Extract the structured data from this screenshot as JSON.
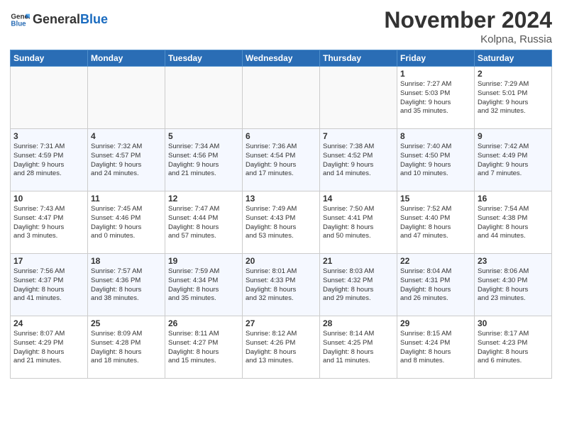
{
  "header": {
    "logo_text_general": "General",
    "logo_text_blue": "Blue",
    "month_title": "November 2024",
    "location": "Kolpna, Russia"
  },
  "weekdays": [
    "Sunday",
    "Monday",
    "Tuesday",
    "Wednesday",
    "Thursday",
    "Friday",
    "Saturday"
  ],
  "weeks": [
    [
      {
        "day": "",
        "info": ""
      },
      {
        "day": "",
        "info": ""
      },
      {
        "day": "",
        "info": ""
      },
      {
        "day": "",
        "info": ""
      },
      {
        "day": "",
        "info": ""
      },
      {
        "day": "1",
        "info": "Sunrise: 7:27 AM\nSunset: 5:03 PM\nDaylight: 9 hours\nand 35 minutes."
      },
      {
        "day": "2",
        "info": "Sunrise: 7:29 AM\nSunset: 5:01 PM\nDaylight: 9 hours\nand 32 minutes."
      }
    ],
    [
      {
        "day": "3",
        "info": "Sunrise: 7:31 AM\nSunset: 4:59 PM\nDaylight: 9 hours\nand 28 minutes."
      },
      {
        "day": "4",
        "info": "Sunrise: 7:32 AM\nSunset: 4:57 PM\nDaylight: 9 hours\nand 24 minutes."
      },
      {
        "day": "5",
        "info": "Sunrise: 7:34 AM\nSunset: 4:56 PM\nDaylight: 9 hours\nand 21 minutes."
      },
      {
        "day": "6",
        "info": "Sunrise: 7:36 AM\nSunset: 4:54 PM\nDaylight: 9 hours\nand 17 minutes."
      },
      {
        "day": "7",
        "info": "Sunrise: 7:38 AM\nSunset: 4:52 PM\nDaylight: 9 hours\nand 14 minutes."
      },
      {
        "day": "8",
        "info": "Sunrise: 7:40 AM\nSunset: 4:50 PM\nDaylight: 9 hours\nand 10 minutes."
      },
      {
        "day": "9",
        "info": "Sunrise: 7:42 AM\nSunset: 4:49 PM\nDaylight: 9 hours\nand 7 minutes."
      }
    ],
    [
      {
        "day": "10",
        "info": "Sunrise: 7:43 AM\nSunset: 4:47 PM\nDaylight: 9 hours\nand 3 minutes."
      },
      {
        "day": "11",
        "info": "Sunrise: 7:45 AM\nSunset: 4:46 PM\nDaylight: 9 hours\nand 0 minutes."
      },
      {
        "day": "12",
        "info": "Sunrise: 7:47 AM\nSunset: 4:44 PM\nDaylight: 8 hours\nand 57 minutes."
      },
      {
        "day": "13",
        "info": "Sunrise: 7:49 AM\nSunset: 4:43 PM\nDaylight: 8 hours\nand 53 minutes."
      },
      {
        "day": "14",
        "info": "Sunrise: 7:50 AM\nSunset: 4:41 PM\nDaylight: 8 hours\nand 50 minutes."
      },
      {
        "day": "15",
        "info": "Sunrise: 7:52 AM\nSunset: 4:40 PM\nDaylight: 8 hours\nand 47 minutes."
      },
      {
        "day": "16",
        "info": "Sunrise: 7:54 AM\nSunset: 4:38 PM\nDaylight: 8 hours\nand 44 minutes."
      }
    ],
    [
      {
        "day": "17",
        "info": "Sunrise: 7:56 AM\nSunset: 4:37 PM\nDaylight: 8 hours\nand 41 minutes."
      },
      {
        "day": "18",
        "info": "Sunrise: 7:57 AM\nSunset: 4:36 PM\nDaylight: 8 hours\nand 38 minutes."
      },
      {
        "day": "19",
        "info": "Sunrise: 7:59 AM\nSunset: 4:34 PM\nDaylight: 8 hours\nand 35 minutes."
      },
      {
        "day": "20",
        "info": "Sunrise: 8:01 AM\nSunset: 4:33 PM\nDaylight: 8 hours\nand 32 minutes."
      },
      {
        "day": "21",
        "info": "Sunrise: 8:03 AM\nSunset: 4:32 PM\nDaylight: 8 hours\nand 29 minutes."
      },
      {
        "day": "22",
        "info": "Sunrise: 8:04 AM\nSunset: 4:31 PM\nDaylight: 8 hours\nand 26 minutes."
      },
      {
        "day": "23",
        "info": "Sunrise: 8:06 AM\nSunset: 4:30 PM\nDaylight: 8 hours\nand 23 minutes."
      }
    ],
    [
      {
        "day": "24",
        "info": "Sunrise: 8:07 AM\nSunset: 4:29 PM\nDaylight: 8 hours\nand 21 minutes."
      },
      {
        "day": "25",
        "info": "Sunrise: 8:09 AM\nSunset: 4:28 PM\nDaylight: 8 hours\nand 18 minutes."
      },
      {
        "day": "26",
        "info": "Sunrise: 8:11 AM\nSunset: 4:27 PM\nDaylight: 8 hours\nand 15 minutes."
      },
      {
        "day": "27",
        "info": "Sunrise: 8:12 AM\nSunset: 4:26 PM\nDaylight: 8 hours\nand 13 minutes."
      },
      {
        "day": "28",
        "info": "Sunrise: 8:14 AM\nSunset: 4:25 PM\nDaylight: 8 hours\nand 11 minutes."
      },
      {
        "day": "29",
        "info": "Sunrise: 8:15 AM\nSunset: 4:24 PM\nDaylight: 8 hours\nand 8 minutes."
      },
      {
        "day": "30",
        "info": "Sunrise: 8:17 AM\nSunset: 4:23 PM\nDaylight: 8 hours\nand 6 minutes."
      }
    ]
  ]
}
